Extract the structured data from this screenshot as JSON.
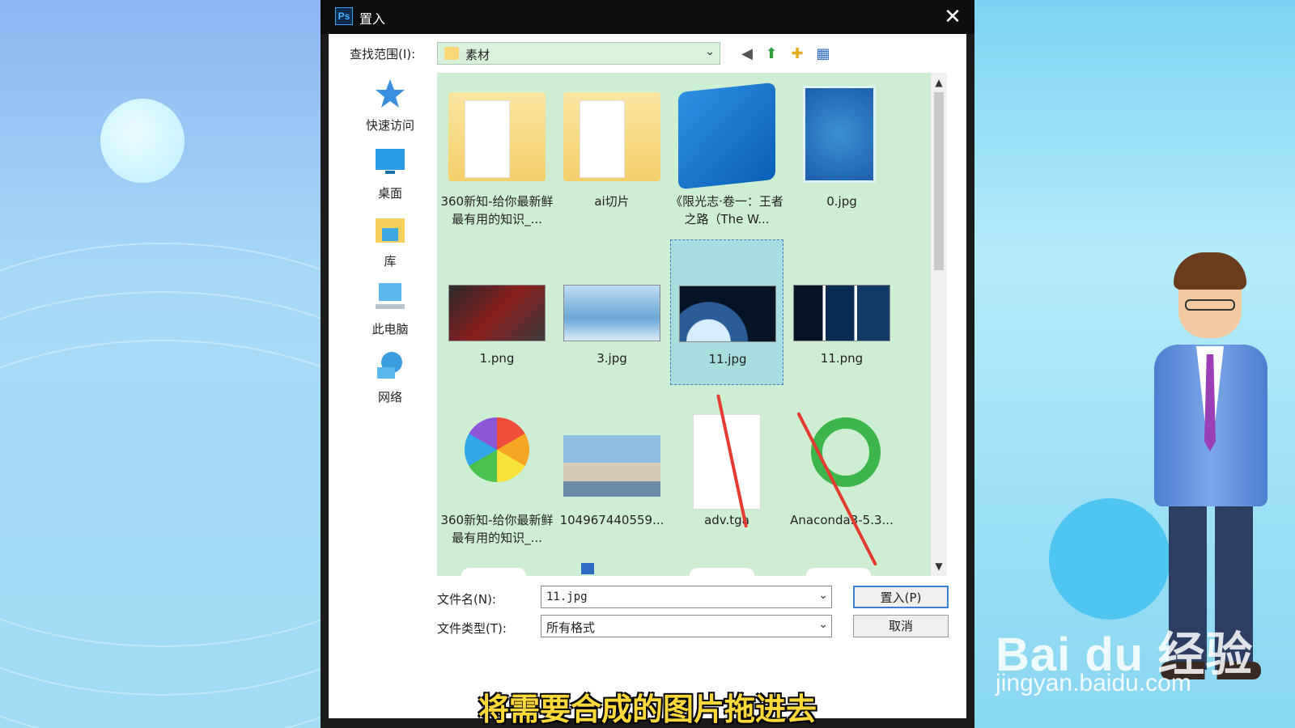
{
  "window": {
    "title": "置入",
    "app_icon": "Ps",
    "close_glyph": "✕"
  },
  "look_in": {
    "label": "查找范围(I):",
    "value": "素材"
  },
  "places": [
    {
      "label": "快速访问",
      "icon": "star-icon"
    },
    {
      "label": "桌面",
      "icon": "desktop-icon"
    },
    {
      "label": "库",
      "icon": "library-icon"
    },
    {
      "label": "此电脑",
      "icon": "computer-icon"
    },
    {
      "label": "网络",
      "icon": "network-icon"
    }
  ],
  "files": [
    {
      "name": "360新知-给你最新鲜最有用的知识_...",
      "type": "folder"
    },
    {
      "name": "ai切片",
      "type": "folder"
    },
    {
      "name": "《限光志·卷一：王者之路（The W...",
      "type": "book"
    },
    {
      "name": "0.jpg",
      "type": "image"
    },
    {
      "name": "1.png",
      "type": "image"
    },
    {
      "name": "3.jpg",
      "type": "image"
    },
    {
      "name": "11.jpg",
      "type": "image",
      "selected": true
    },
    {
      "name": "11.png",
      "type": "image"
    },
    {
      "name": "360新知-给你最新鲜最有用的知识_...",
      "type": "app"
    },
    {
      "name": "104967440559...",
      "type": "image"
    },
    {
      "name": "adv.tga",
      "type": "document"
    },
    {
      "name": "Anaconda3-5.3...",
      "type": "installer"
    }
  ],
  "filename": {
    "label": "文件名(N):",
    "value": "11.jpg"
  },
  "filetype": {
    "label": "文件类型(T):",
    "value": "所有格式"
  },
  "buttons": {
    "place": "置入(P)",
    "cancel": "取消"
  },
  "subtitle": "将需要合成的图片拖进去",
  "watermark": {
    "brand": "Bai du 经验",
    "url": "jingyan.baidu.com"
  },
  "colors": {
    "file_area_bg": "#cdeed3",
    "annotation_arrow": "#e53a2f",
    "subtitle_text": "#ffd93a"
  }
}
